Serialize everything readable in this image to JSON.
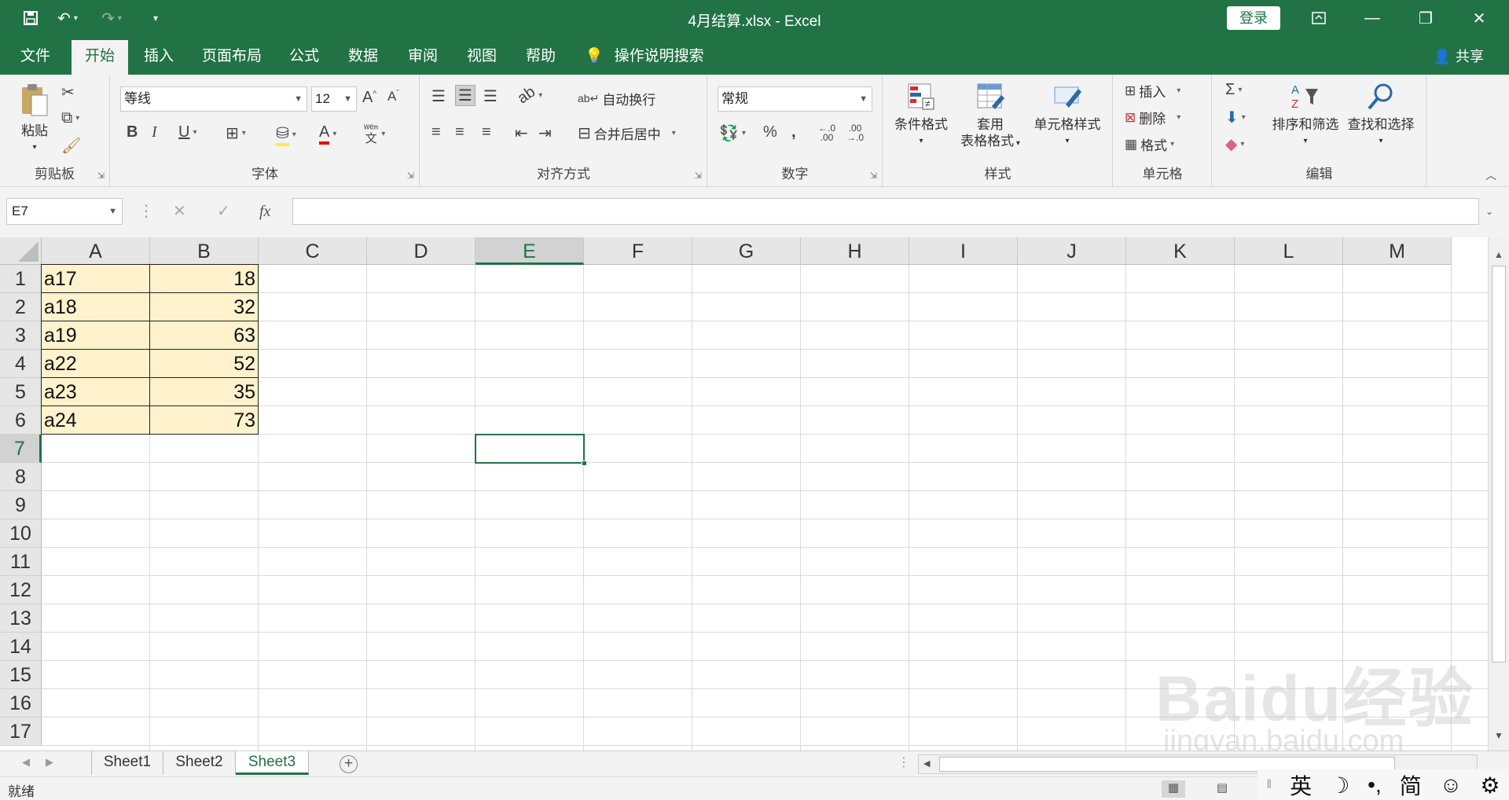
{
  "window": {
    "title": "4月结算.xlsx  -  Excel",
    "login_label": "登录",
    "qa_save_icon": "save-icon",
    "qa_undo_icon": "undo-icon",
    "qa_redo_icon": "redo-icon"
  },
  "tabs": [
    {
      "label": "文件",
      "active": false
    },
    {
      "label": "开始",
      "active": true
    },
    {
      "label": "插入",
      "active": false
    },
    {
      "label": "页面布局",
      "active": false
    },
    {
      "label": "公式",
      "active": false
    },
    {
      "label": "数据",
      "active": false
    },
    {
      "label": "审阅",
      "active": false
    },
    {
      "label": "视图",
      "active": false
    },
    {
      "label": "帮助",
      "active": false
    }
  ],
  "tell_me": "操作说明搜索",
  "share": "共享",
  "ribbon": {
    "clipboard": {
      "label": "剪贴板",
      "paste": "粘贴"
    },
    "font": {
      "label": "字体",
      "font_name": "等线",
      "font_size": "12"
    },
    "alignment": {
      "label": "对齐方式",
      "wrap": "自动换行",
      "merge": "合并后居中"
    },
    "number": {
      "label": "数字",
      "format": "常规",
      "percent": "%",
      "comma": ","
    },
    "styles": {
      "label": "样式",
      "conditional": "条件格式",
      "table_1": "套用",
      "table_2": "表格格式",
      "cell_styles": "单元格样式"
    },
    "cells": {
      "label": "单元格",
      "insert": "插入",
      "delete": "删除",
      "format": "格式"
    },
    "editing": {
      "label": "编辑",
      "sort": "排序和筛选",
      "find": "查找和选择"
    }
  },
  "formula_bar": {
    "name_box": "E7",
    "formula": ""
  },
  "columns": [
    "A",
    "B",
    "C",
    "D",
    "E",
    "F",
    "G",
    "H",
    "I",
    "J",
    "K",
    "L",
    "M"
  ],
  "selected_column": "E",
  "rows": [
    "1",
    "2",
    "3",
    "4",
    "5",
    "6",
    "7",
    "8",
    "9",
    "10",
    "11",
    "12",
    "13",
    "14",
    "15",
    "16",
    "17"
  ],
  "selected_row": "7",
  "cells": [
    {
      "a": "a17",
      "b": "18"
    },
    {
      "a": "a18",
      "b": "32"
    },
    {
      "a": "a19",
      "b": "63"
    },
    {
      "a": "a22",
      "b": "52"
    },
    {
      "a": "a23",
      "b": "35"
    },
    {
      "a": "a24",
      "b": "73"
    }
  ],
  "sheets": [
    {
      "label": "Sheet1",
      "active": false
    },
    {
      "label": "Sheet2",
      "active": false
    },
    {
      "label": "Sheet3",
      "active": true
    }
  ],
  "status": "就绪",
  "ime": {
    "lang": "英",
    "moon": "☽",
    "punct": "•,",
    "simp": "简",
    "emoji": "☺",
    "gear": "⚙"
  },
  "watermark": {
    "line1": "Baidu经验",
    "line2": "jingyan.baidu.com"
  },
  "colors": {
    "accent": "#217346",
    "cell_fill": "#fff2cc"
  }
}
